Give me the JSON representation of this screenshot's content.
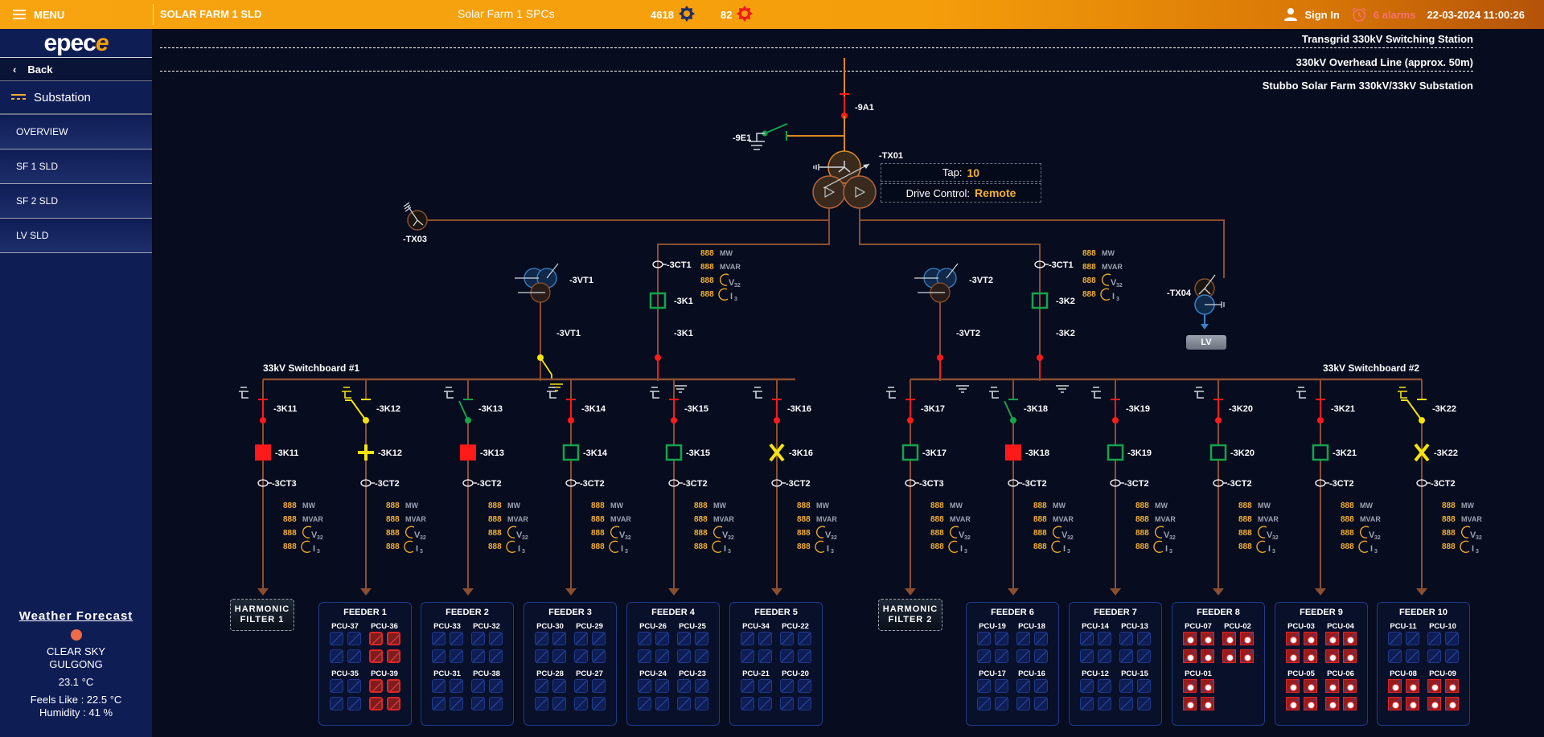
{
  "topbar": {
    "menu_label": "MENU",
    "page_title": "SOLAR FARM 1 SLD",
    "spcs_label": "Solar Farm 1 SPCs",
    "counter_ok": "4618",
    "counter_fault": "82",
    "sign_in": "Sign In",
    "alarms": "6 alarms",
    "datetime": "22-03-2024 11:00:26",
    "colors": {
      "ok_gear": "#1e2f6b",
      "fault_gear": "#ef1c1c"
    }
  },
  "sidebar": {
    "logo_text": "epec",
    "logo_mark": "e",
    "back": "Back",
    "section": "Substation",
    "items": [
      {
        "label": "OVERVIEW"
      },
      {
        "label": "SF 1 SLD"
      },
      {
        "label": "SF 2 SLD"
      },
      {
        "label": "LV SLD"
      }
    ]
  },
  "weather": {
    "title": "Weather Forecast",
    "condition": "CLEAR SKY",
    "location": "GULGONG",
    "temp": "23.1 °C",
    "feels_like": "Feels Like : 22.5 °C",
    "humidity": "Humidity : 41 %"
  },
  "diagram": {
    "headers": [
      "Transgrid 330kV Switching Station",
      "330kV Overhead Line (approx. 50m)",
      "Stubbo Solar Farm 330kV/33kV Substation"
    ],
    "main": {
      "disconnector": "-9A1",
      "earth_switch": "-9E1",
      "transformer": "-TX01",
      "tap_label": "Tap:",
      "tap_value": "10",
      "drive_label": "Drive Control:",
      "drive_value": "Remote",
      "aux_tx_left": "-TX03",
      "aux_tx_right": "-TX04",
      "lv_button": "LV"
    },
    "incomers": [
      {
        "vt": "-3VT1",
        "vt_switch": "-3VT1",
        "ct": "-3CT1",
        "breaker": "-3K1",
        "disconnector": "-3K1"
      },
      {
        "vt": "-3VT2",
        "vt_switch": "-3VT2",
        "ct": "-3CT1",
        "breaker": "-3K2",
        "disconnector": "-3K2"
      }
    ],
    "meter_units": {
      "mw": "MW",
      "mvar": "MVAR",
      "v": "V",
      "v_sub": "32",
      "i": "I",
      "i_sub": "3"
    },
    "meter_value": "888",
    "switchboards": [
      "33kV Switchboard #1",
      "33kV Switchboard #2"
    ],
    "bays": [
      {
        "id": "-3K11",
        "ct": "-3CT3",
        "disc": "closed-red",
        "breaker": "red-filled"
      },
      {
        "id": "-3K12",
        "ct": "-3CT2",
        "disc": "earthed-yellow",
        "breaker": "yellow-plus"
      },
      {
        "id": "-3K13",
        "ct": "-3CT2",
        "disc": "open-green",
        "breaker": "red-filled"
      },
      {
        "id": "-3K14",
        "ct": "-3CT2",
        "disc": "closed-red",
        "breaker": "green-open"
      },
      {
        "id": "-3K15",
        "ct": "-3CT2",
        "disc": "closed-red",
        "breaker": "green-open"
      },
      {
        "id": "-3K16",
        "ct": "-3CT2",
        "disc": "closed-red",
        "breaker": "yellow-x"
      },
      {
        "id": "-3K17",
        "ct": "-3CT3",
        "disc": "closed-red",
        "breaker": "green-open"
      },
      {
        "id": "-3K18",
        "ct": "-3CT2",
        "disc": "open-green",
        "breaker": "red-filled"
      },
      {
        "id": "-3K19",
        "ct": "-3CT2",
        "disc": "closed-red",
        "breaker": "green-open"
      },
      {
        "id": "-3K20",
        "ct": "-3CT2",
        "disc": "closed-red",
        "breaker": "green-open"
      },
      {
        "id": "-3K21",
        "ct": "-3CT2",
        "disc": "closed-red",
        "breaker": "green-open"
      },
      {
        "id": "-3K22",
        "ct": "-3CT2",
        "disc": "earthed-yellow",
        "breaker": "yellow-x"
      }
    ],
    "harmonic_filters": [
      {
        "line1": "HARMONIC",
        "line2": "FILTER  1"
      },
      {
        "line1": "HARMONIC",
        "line2": "FILTER  2"
      }
    ],
    "feeders": [
      {
        "title": "FEEDER 1",
        "pcus": [
          {
            "name": "PCU-37",
            "state": "normal"
          },
          {
            "name": "PCU-36",
            "state": "fault"
          },
          {
            "name": "PCU-35",
            "state": "normal"
          },
          {
            "name": "PCU-39",
            "state": "fault"
          }
        ]
      },
      {
        "title": "FEEDER 2",
        "pcus": [
          {
            "name": "PCU-33",
            "state": "normal"
          },
          {
            "name": "PCU-32",
            "state": "normal"
          },
          {
            "name": "PCU-31",
            "state": "normal"
          },
          {
            "name": "PCU-38",
            "state": "normal"
          }
        ]
      },
      {
        "title": "FEEDER 3",
        "pcus": [
          {
            "name": "PCU-30",
            "state": "normal"
          },
          {
            "name": "PCU-29",
            "state": "normal"
          },
          {
            "name": "PCU-28",
            "state": "normal"
          },
          {
            "name": "PCU-27",
            "state": "normal"
          }
        ]
      },
      {
        "title": "FEEDER 4",
        "pcus": [
          {
            "name": "PCU-26",
            "state": "normal"
          },
          {
            "name": "PCU-25",
            "state": "normal"
          },
          {
            "name": "PCU-24",
            "state": "normal"
          },
          {
            "name": "PCU-23",
            "state": "normal"
          }
        ]
      },
      {
        "title": "FEEDER 5",
        "pcus": [
          {
            "name": "PCU-34",
            "state": "normal"
          },
          {
            "name": "PCU-22",
            "state": "normal"
          },
          {
            "name": "PCU-21",
            "state": "normal"
          },
          {
            "name": "PCU-20",
            "state": "normal"
          }
        ]
      },
      {
        "title": "FEEDER 6",
        "pcus": [
          {
            "name": "PCU-19",
            "state": "normal"
          },
          {
            "name": "PCU-18",
            "state": "normal"
          },
          {
            "name": "PCU-17",
            "state": "normal"
          },
          {
            "name": "PCU-16",
            "state": "normal"
          }
        ]
      },
      {
        "title": "FEEDER 7",
        "pcus": [
          {
            "name": "PCU-14",
            "state": "normal"
          },
          {
            "name": "PCU-13",
            "state": "normal"
          },
          {
            "name": "PCU-12",
            "state": "normal"
          },
          {
            "name": "PCU-15",
            "state": "normal"
          }
        ]
      },
      {
        "title": "FEEDER 8",
        "pcus": [
          {
            "name": "PCU-07",
            "state": "trip"
          },
          {
            "name": "PCU-02",
            "state": "trip"
          },
          {
            "name": "PCU-01",
            "state": "trip"
          }
        ]
      },
      {
        "title": "FEEDER 9",
        "pcus": [
          {
            "name": "PCU-03",
            "state": "trip"
          },
          {
            "name": "PCU-04",
            "state": "trip"
          },
          {
            "name": "PCU-05",
            "state": "trip"
          },
          {
            "name": "PCU-06",
            "state": "trip"
          }
        ]
      },
      {
        "title": "FEEDER 10",
        "pcus": [
          {
            "name": "PCU-11",
            "state": "normal"
          },
          {
            "name": "PCU-10",
            "state": "normal"
          },
          {
            "name": "PCU-08",
            "state": "trip"
          },
          {
            "name": "PCU-09",
            "state": "trip"
          }
        ]
      }
    ],
    "colors": {
      "busbar": "#8b4f2f",
      "hv_line": "#d98a1f",
      "closed": "#ff1a1a",
      "open": "#16a34a",
      "earthed": "#f5e50b",
      "meter_value": "#f5b02a"
    }
  }
}
